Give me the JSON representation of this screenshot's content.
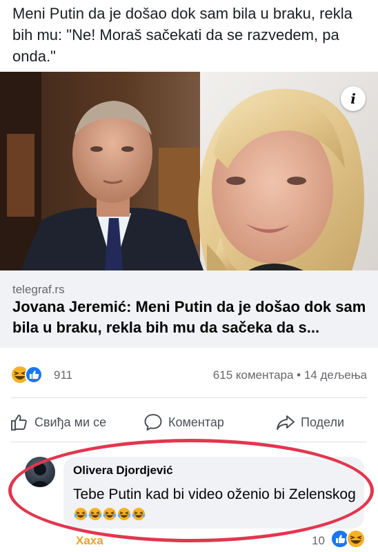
{
  "post": {
    "text": "Meni Putin da je došao dok sam bila u braku, rekla bih mu: \"Ne! Moraš sačekati da se razvedem, pa onda.\""
  },
  "link_preview": {
    "domain": "telegraf.rs",
    "headline": "Jovana Jeremić: Meni Putin da je došao dok sam bila u braku, rekla bih mu da sačeka da s...",
    "info_icon_label": "i"
  },
  "stats": {
    "reaction_count": "911",
    "comments_shares": "615 коментара • 14 дељења"
  },
  "actions": {
    "like": "Свиђа ми се",
    "comment": "Коментар",
    "share": "Подели"
  },
  "comment": {
    "author": "Olivera Djordjević",
    "text": "Tebe Putin kad bi video oženio bi Zelenskog",
    "emoji_count": 5,
    "haha_label": "Хаха",
    "reaction_count": "10"
  },
  "colors": {
    "facebook_blue": "#1877f2",
    "highlight_red": "#e2364f",
    "haha_yellow": "#f7b125"
  }
}
